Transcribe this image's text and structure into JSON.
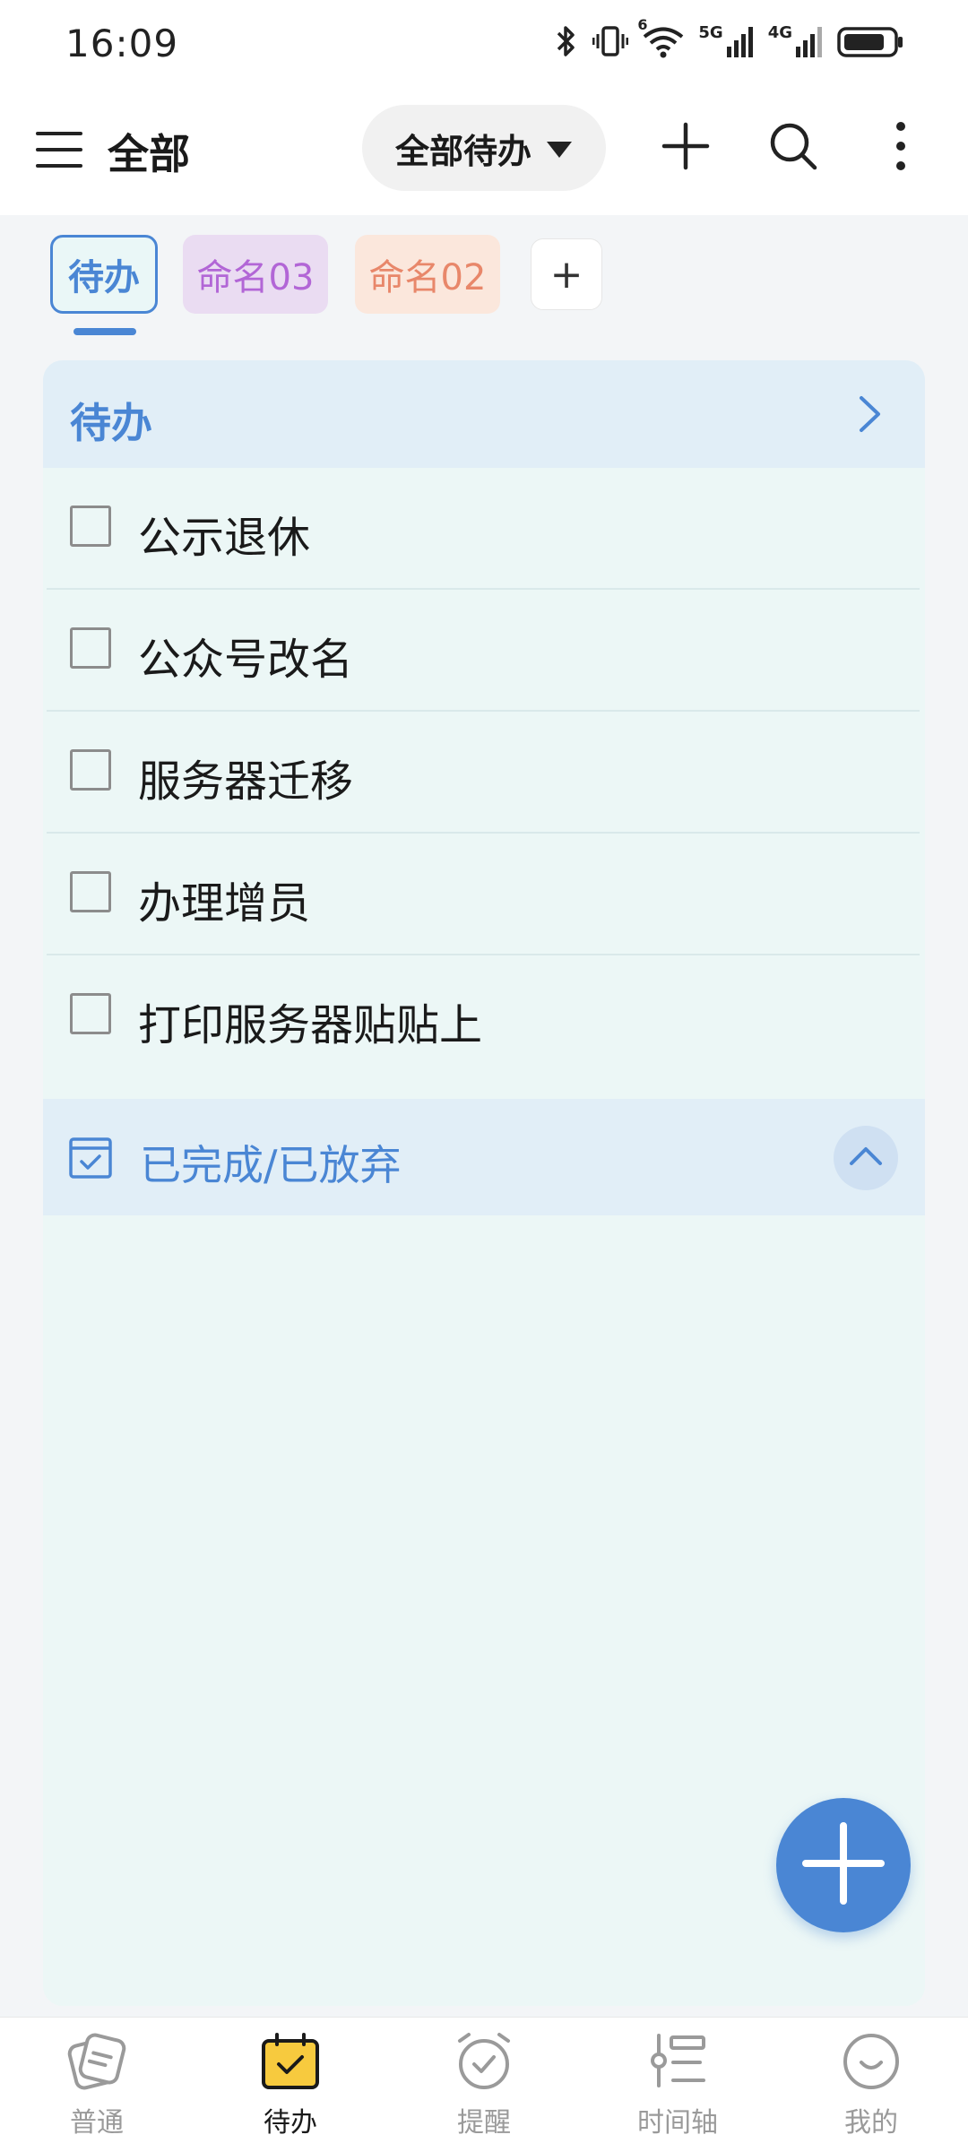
{
  "status_bar": {
    "time": "16:09",
    "network_5g": "5G",
    "network_4g": "4G",
    "wifi_badge": "6"
  },
  "header": {
    "title": "全部",
    "filter_label": "全部待办",
    "icons": [
      "menu-icon",
      "add-icon",
      "search-icon",
      "more-icon"
    ]
  },
  "tabs": [
    {
      "label": "待办",
      "active": true,
      "color": "#4a86d4"
    },
    {
      "label": "命名03",
      "active": false,
      "color": "#b266d6"
    },
    {
      "label": "命名02",
      "active": false,
      "color": "#e8876a"
    },
    {
      "label": "+",
      "active": false
    }
  ],
  "todo_section": {
    "title": "待办",
    "tasks": [
      {
        "text": "公示退休",
        "done": false
      },
      {
        "text": "公众号改名",
        "done": false
      },
      {
        "text": "服务器迁移",
        "done": false
      },
      {
        "text": "办理增员",
        "done": false
      },
      {
        "text": "打印服务器贴贴上",
        "done": false
      }
    ]
  },
  "done_section": {
    "title": "已完成/已放弃",
    "expanded": true
  },
  "bottom_nav": [
    {
      "label": "普通",
      "icon": "notes-icon",
      "active": false
    },
    {
      "label": "待办",
      "icon": "todo-calendar-icon",
      "active": true
    },
    {
      "label": "提醒",
      "icon": "alarm-icon",
      "active": false
    },
    {
      "label": "时间轴",
      "icon": "timeline-icon",
      "active": false
    },
    {
      "label": "我的",
      "icon": "smile-icon",
      "active": false
    }
  ],
  "colors": {
    "accent": "#4a86d4",
    "card_background": "#ecf7f6",
    "section_header": "#e1eef7",
    "active_nav_icon": "#f7ca3e"
  }
}
